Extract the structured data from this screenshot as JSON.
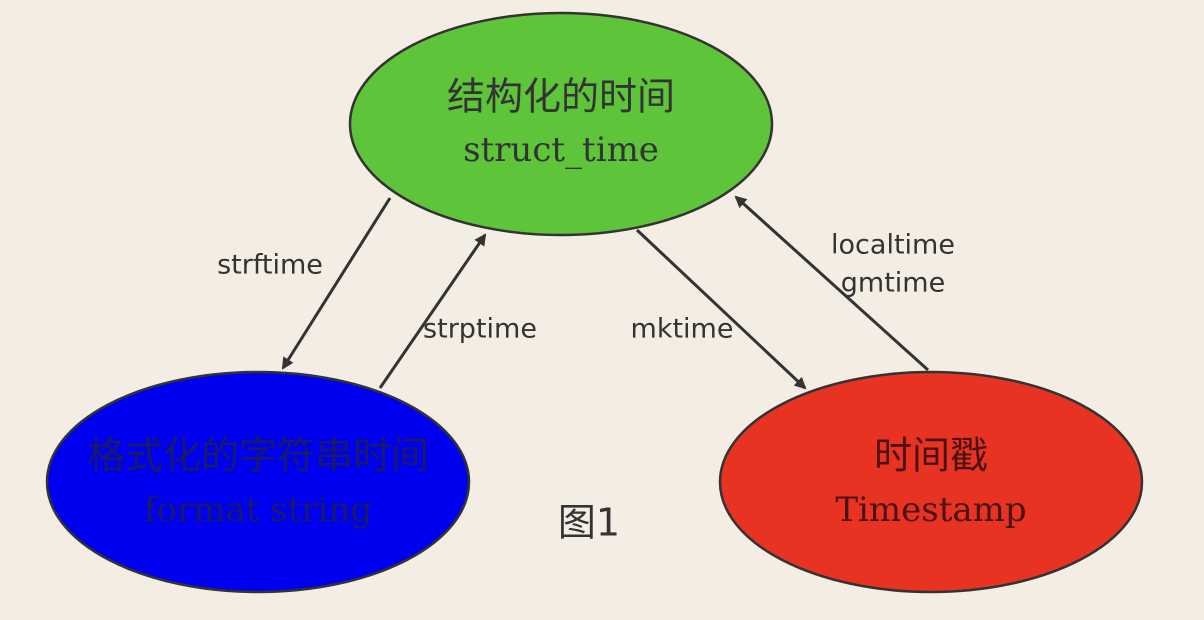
{
  "nodes": {
    "struct": {
      "title": "结构化的时间",
      "subtitle": "struct_time",
      "color": "#5ec43a",
      "text_color": "#333333"
    },
    "format": {
      "title": "格式化的字符串时间",
      "subtitle": "format string",
      "color": "#0000f0",
      "text_color": "#1a1a66"
    },
    "timestamp": {
      "title": "时间戳",
      "subtitle": "Timestamp",
      "color": "#e83322",
      "text_color": "#4a1212"
    }
  },
  "edges": {
    "strftime": "strftime",
    "strptime": "strptime",
    "mktime": "mktime",
    "localtime": "localtime",
    "gmtime": "gmtime"
  },
  "caption": "图1",
  "colors": {
    "background": "#f4ede4",
    "line": "#333333"
  }
}
